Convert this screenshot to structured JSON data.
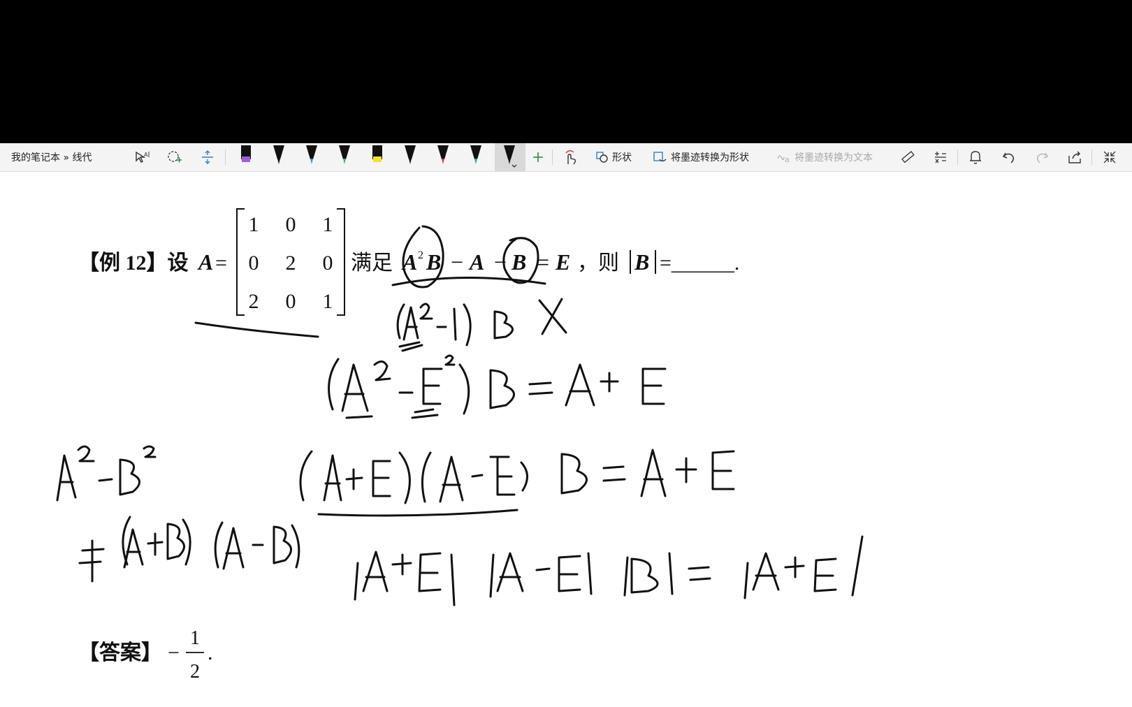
{
  "breadcrumb": "我的笔记本 » 线代",
  "toolbar": {
    "shapes_label": "形状",
    "ink_to_shape_label": "将墨迹转换为形状",
    "ink_to_text_label": "将墨迹转换为文本",
    "pens": [
      {
        "color": "#a55bd6",
        "kind": "highlighter"
      },
      {
        "color": "#111111",
        "kind": "pen"
      },
      {
        "color": "#2f8fe8",
        "kind": "pen"
      },
      {
        "color": "#3bb54a",
        "kind": "pen"
      },
      {
        "color": "#f2e230",
        "kind": "highlighter"
      },
      {
        "color": "#111111",
        "kind": "pen"
      },
      {
        "color": "#e03232",
        "kind": "pen"
      },
      {
        "color": "#1aa6a0",
        "kind": "pen"
      },
      {
        "color": "#111111",
        "kind": "pen-selected"
      }
    ],
    "icons": [
      "lasso-select-icon",
      "add-space-icon",
      "insert-space-icon",
      "add-pen-icon",
      "touch-draw-icon",
      "ruler-icon",
      "math-icon",
      "bell-icon",
      "undo-icon",
      "redo-icon",
      "share-icon",
      "collapse-icon"
    ]
  },
  "problem": {
    "label": "【例 12】设",
    "matrix_name": "A",
    "equals": "=",
    "matrix": [
      [
        "1",
        "0",
        "1"
      ],
      [
        "0",
        "2",
        "0"
      ],
      [
        "2",
        "0",
        "1"
      ]
    ],
    "condition_prefix": "满足",
    "equation": [
      "A",
      "2",
      "B",
      "−",
      "A",
      "−",
      "B",
      "=",
      "E"
    ],
    "then_text": "，则",
    "det_var": "B",
    "blank": "=______."
  },
  "answer": {
    "label": "【答案】",
    "sign": "−",
    "numerator": "1",
    "denominator": "2",
    "end": "."
  },
  "ink_colors": {
    "ink": "#111111"
  }
}
